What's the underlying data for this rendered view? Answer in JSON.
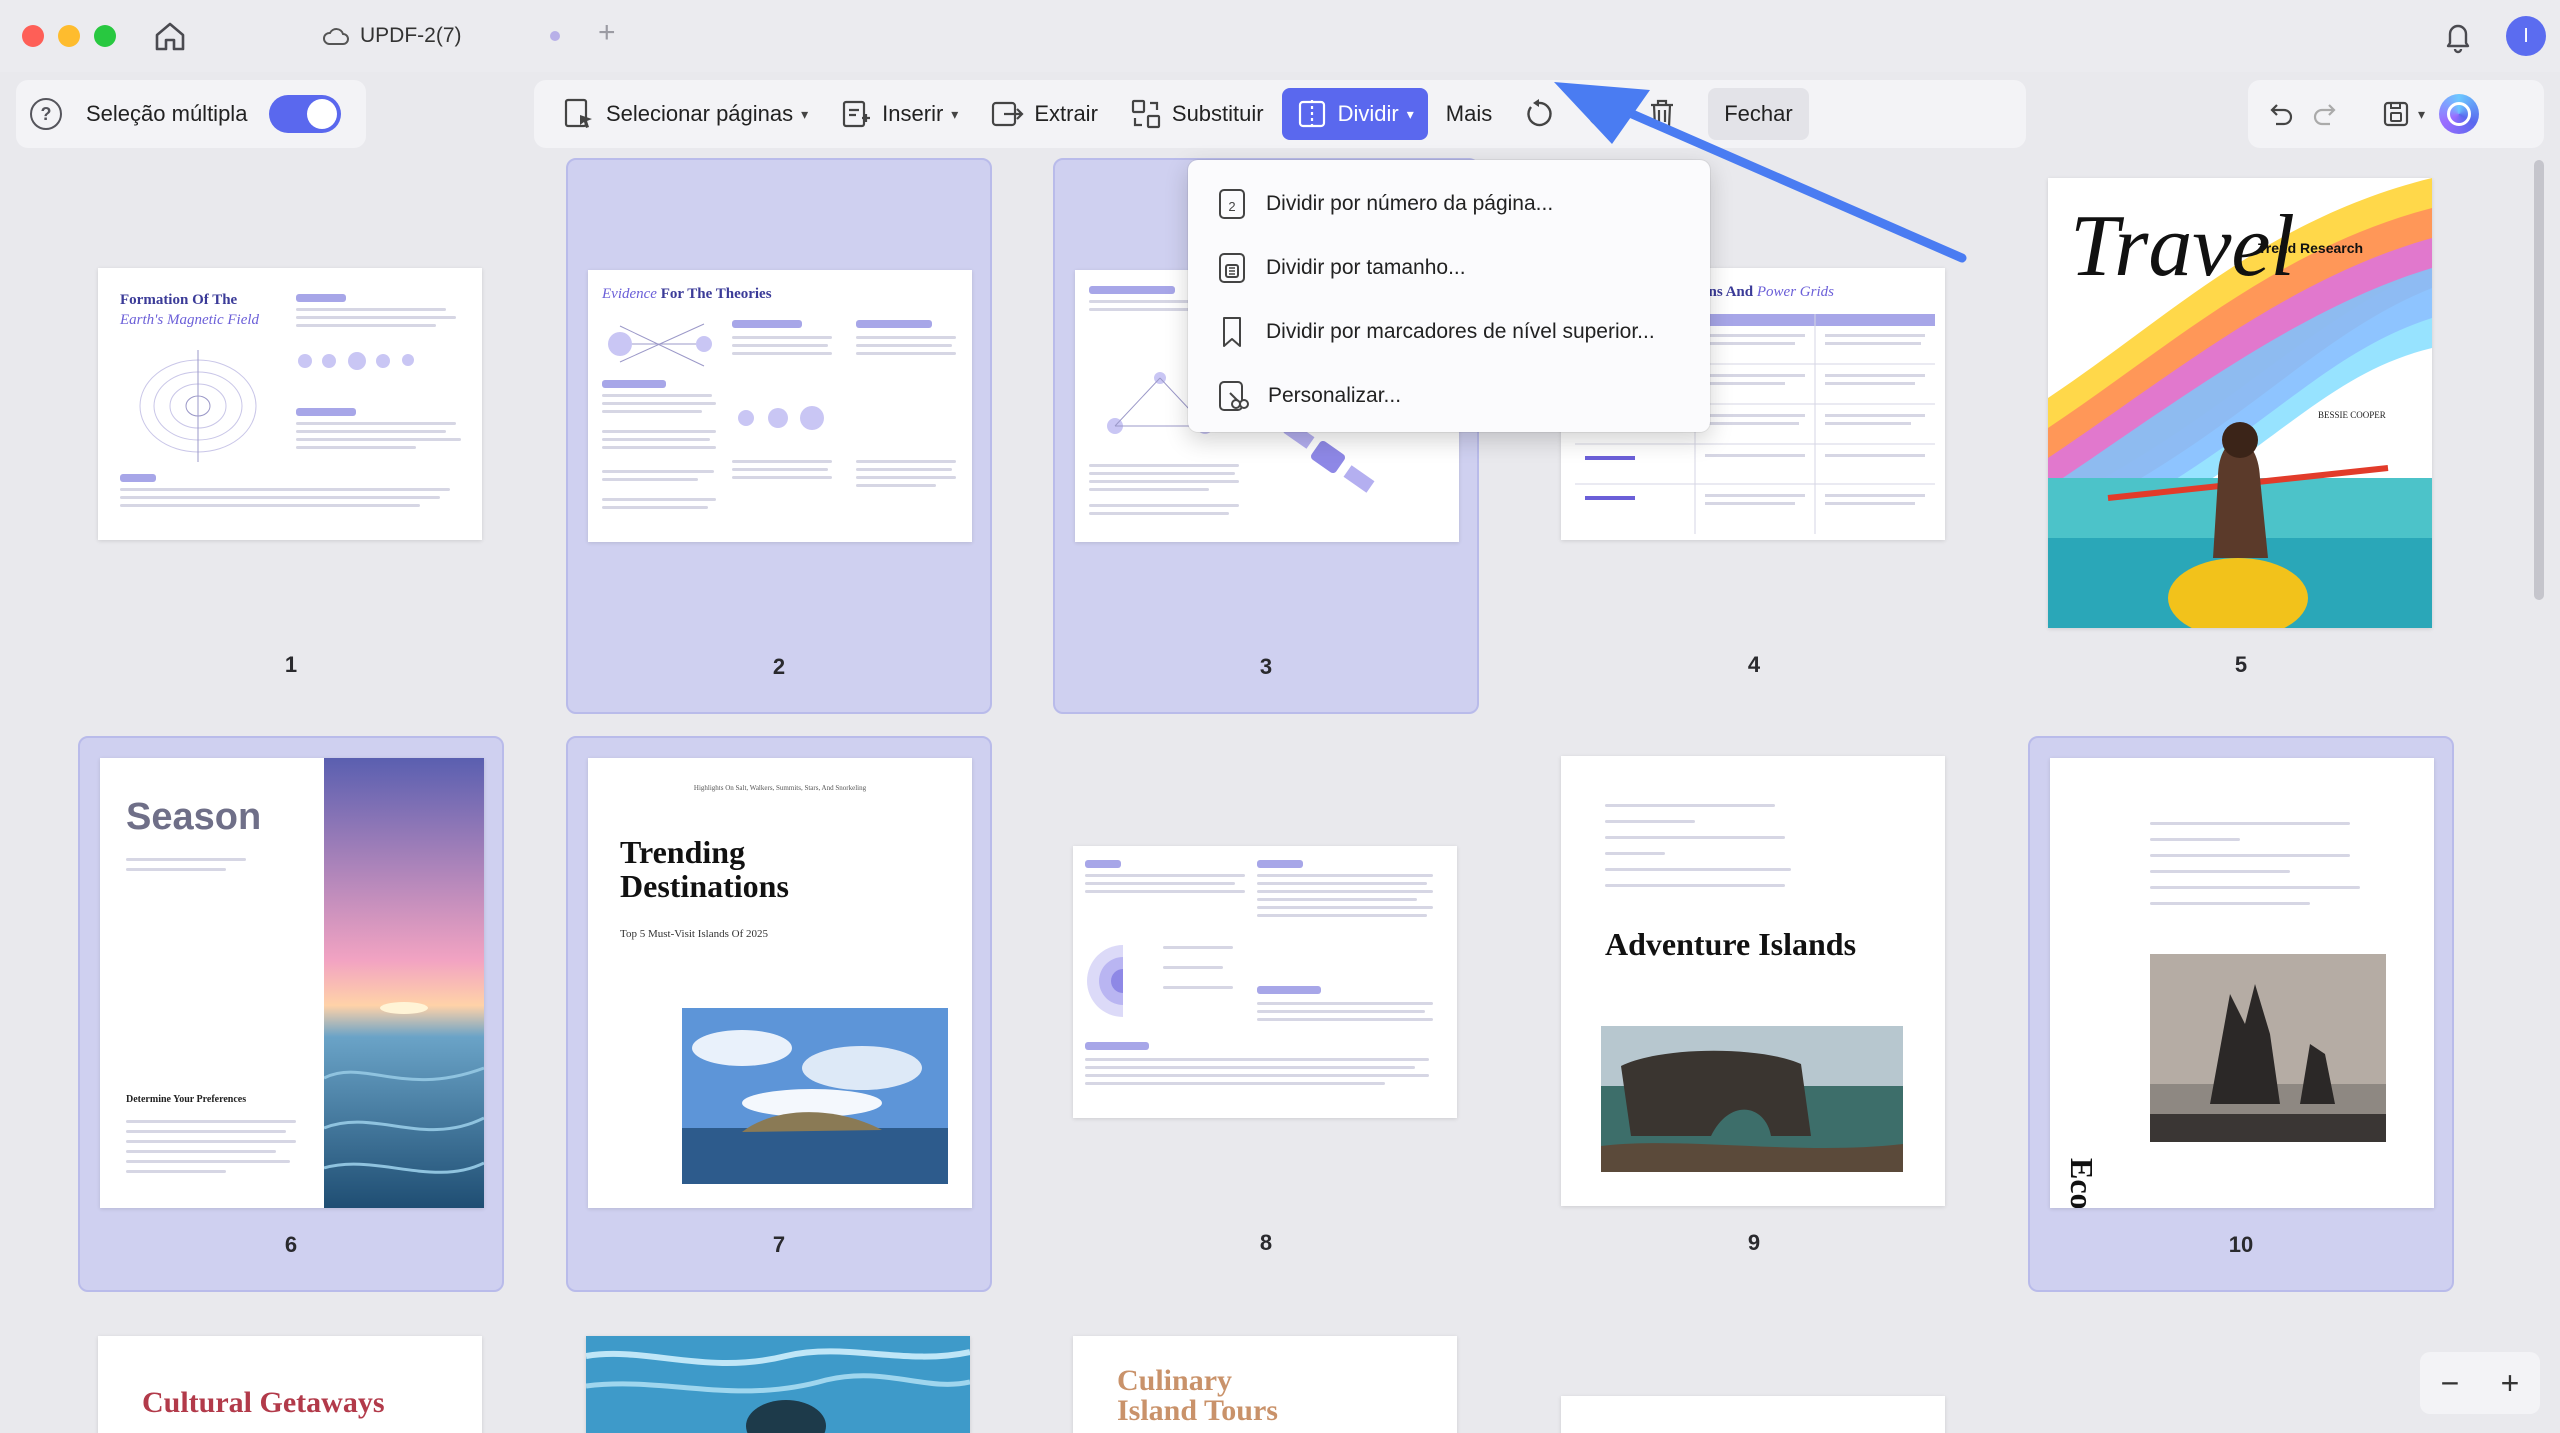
{
  "window": {
    "doc_tab_title": "UPDF-2(7)",
    "tab_add": "+",
    "avatar_initial": "I"
  },
  "toolbar_left": {
    "help": "?",
    "multi_select_label": "Seleção múltipla",
    "multi_select_on": true
  },
  "toolbar": {
    "select_pages": "Selecionar páginas",
    "insert": "Inserir",
    "extract": "Extrair",
    "replace": "Substituir",
    "split": "Dividir",
    "more": "Mais",
    "close": "Fechar"
  },
  "split_menu": {
    "items": [
      {
        "label": "Dividir por número da página...",
        "icon": "page-number-icon"
      },
      {
        "label": "Dividir por tamanho...",
        "icon": "file-size-icon"
      },
      {
        "label": "Dividir por marcadores de nível superior...",
        "icon": "bookmark-icon"
      },
      {
        "label": "Personalizar...",
        "icon": "custom-split-icon"
      }
    ]
  },
  "pages": [
    {
      "number": "1",
      "selected": false,
      "title_a": "Formation Of The",
      "title_b": "Earth's Magnetic Field"
    },
    {
      "number": "2",
      "selected": true,
      "title_a": "Evidence",
      "title_b": "For The Theories"
    },
    {
      "number": "3",
      "selected": true
    },
    {
      "number": "4",
      "selected": false,
      "title_a": "ons And",
      "title_b": "Power Grids"
    },
    {
      "number": "5",
      "selected": false,
      "script_title": "Travel",
      "kicker": "Trend Research",
      "author": "BESSIE COOPER"
    },
    {
      "number": "6",
      "selected": true,
      "title": "Season",
      "subtitle": "Determine Your Preferences"
    },
    {
      "number": "7",
      "selected": true,
      "title": "Trending Destinations",
      "subtitle": "Top 5 Must-Visit Islands Of 2025",
      "kicker": "Highlights On Salt, Walkers, Summits, Stars, And Snorkeling"
    },
    {
      "number": "8",
      "selected": false
    },
    {
      "number": "9",
      "selected": false,
      "title": "Adventure Islands"
    },
    {
      "number": "10",
      "selected": true,
      "title": "Eco-Friendly Retreats"
    }
  ],
  "next_row": {
    "p11_title": "Cultural Getaways",
    "p13_title": "Culinary Island Tours"
  },
  "zoom": {
    "minus": "−",
    "plus": "+"
  },
  "colors": {
    "accent": "#5a68ee",
    "selected_cell": "#cfd0f0",
    "arrow": "#4a7cf2"
  }
}
